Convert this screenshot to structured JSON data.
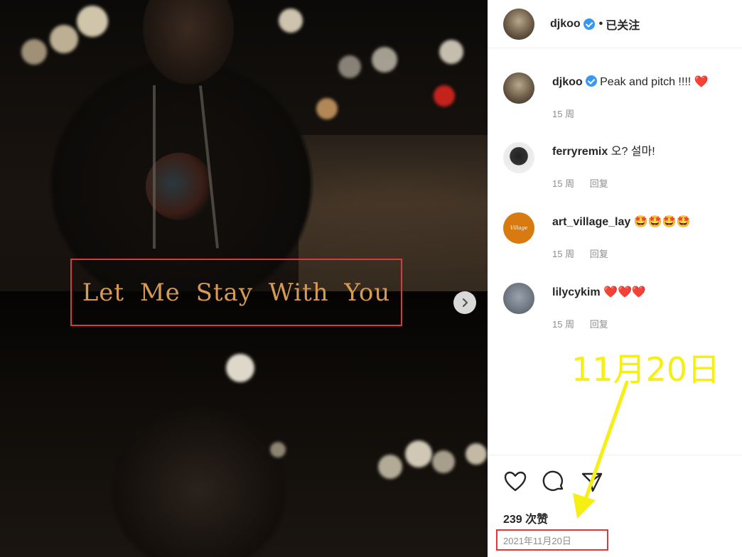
{
  "media": {
    "caption": "Let Me Stay With You"
  },
  "header": {
    "username": "djkoo",
    "follow_status": "已关注",
    "separator": "•"
  },
  "comments": [
    {
      "username": "djkoo",
      "text": "Peak and pitch !!!! ❤️",
      "age": "15 周",
      "reply": "",
      "verified": true
    },
    {
      "username": "ferryremix",
      "text": "오? 설마!",
      "age": "15 周",
      "reply": "回复"
    },
    {
      "username": "art_village_lay",
      "text": "🤩🤩🤩🤩",
      "age": "15 周",
      "reply": "回复"
    },
    {
      "username": "lilycykim",
      "text": "❤️❤️❤️",
      "age": "15 周",
      "reply": "回复"
    }
  ],
  "actions": {
    "likes": "239 次赞",
    "date": "2021年11月20日"
  },
  "annotation": {
    "text": "11月20日",
    "color": "#f7ef13"
  },
  "colors": {
    "highlight_box": "#e03838",
    "caption_text": "#d79a52",
    "verified_badge": "#3897f0"
  },
  "icons": [
    "heart-icon",
    "comment-icon",
    "share-icon",
    "chevron-right-icon",
    "verified-badge-icon"
  ]
}
